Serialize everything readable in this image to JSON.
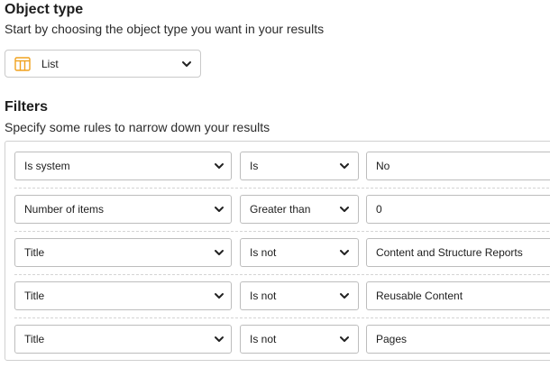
{
  "object_type": {
    "title": "Object type",
    "subtitle": "Start by choosing the object type you want in your results",
    "selected": "List",
    "icon": "list-table-icon",
    "accent_color": "#f0a21e"
  },
  "filters": {
    "title": "Filters",
    "subtitle": "Specify some rules to narrow down your results",
    "rows": [
      {
        "field": "Is system",
        "operator": "Is",
        "value": "No"
      },
      {
        "field": "Number of items",
        "operator": "Greater than",
        "value": "0"
      },
      {
        "field": "Title",
        "operator": "Is not",
        "value": "Content and Structure Reports"
      },
      {
        "field": "Title",
        "operator": "Is not",
        "value": "Reusable Content"
      },
      {
        "field": "Title",
        "operator": "Is not",
        "value": "Pages"
      }
    ]
  }
}
